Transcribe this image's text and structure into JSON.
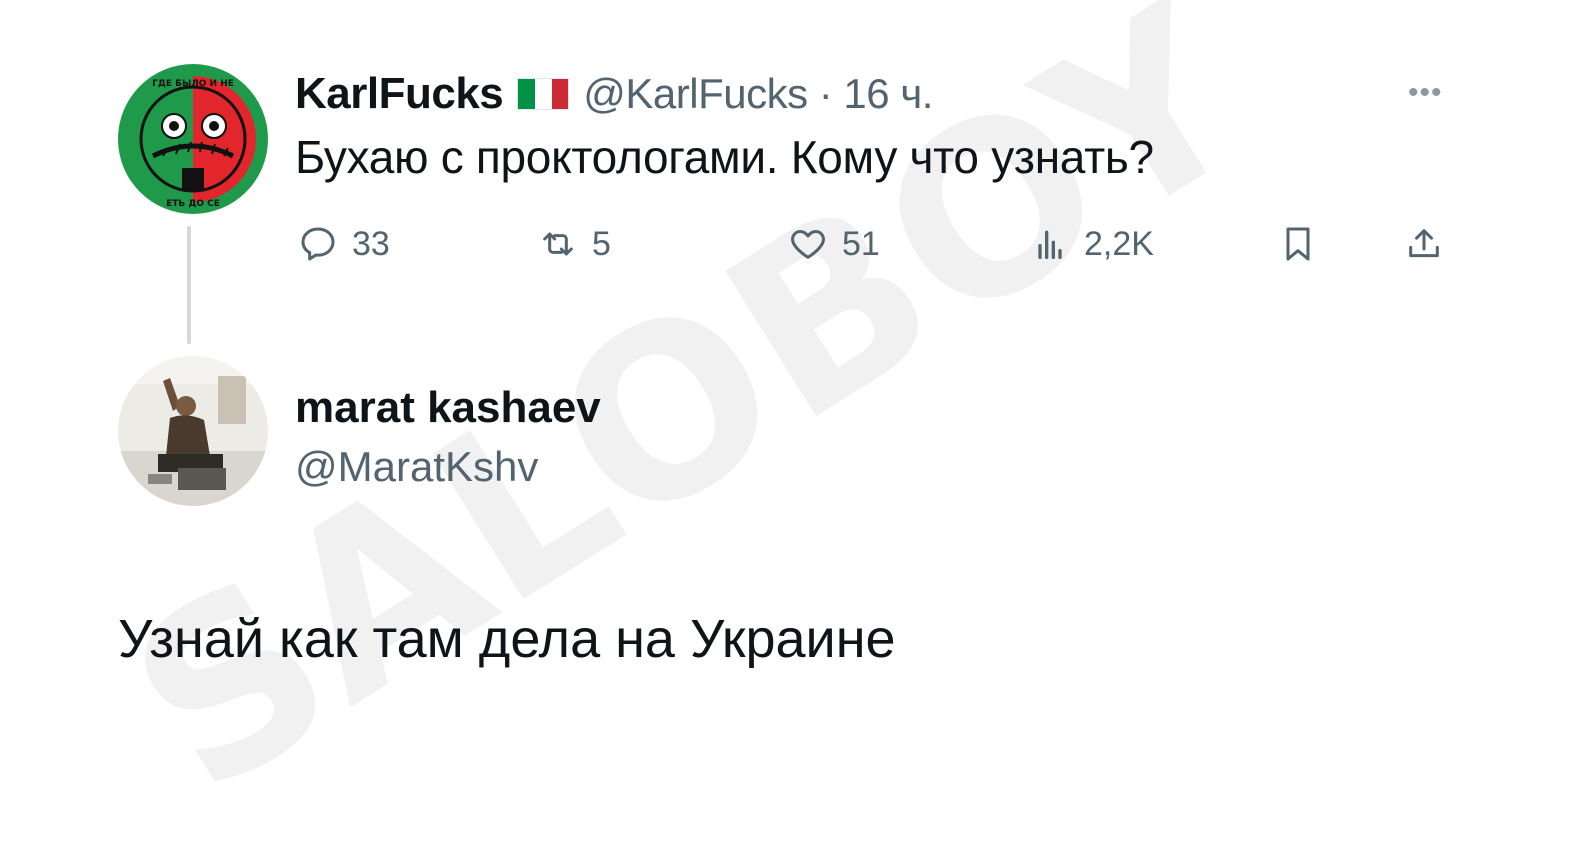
{
  "watermark": "SALOBOY",
  "tweet": {
    "author_name": "KarlFucks",
    "author_flag_colors": [
      "#009246",
      "#ffffff",
      "#ce2b37"
    ],
    "handle_time": "@KarlFucks · 16 ч.",
    "more_icon": "more-icon",
    "avatar_top_text": "ГДЕ БЫЛО И НЕ",
    "avatar_bottom_text": "ЕТЬ ДО СЕ",
    "text": "Бухаю с проктологами. Кому что узнать?",
    "actions": {
      "reply_count": "33",
      "retweet_count": "5",
      "like_count": "51",
      "views_count": "2,2K"
    }
  },
  "reply": {
    "author_name": "marat kashaev",
    "handle": "@MaratKshv",
    "text": "Узнай как там дела на Украине"
  },
  "colors": {
    "text_primary": "#0f1419",
    "text_secondary": "#536471",
    "thread_line": "#cfd9de",
    "avatar_green": "#1f9a4a",
    "avatar_red": "#e3262b"
  }
}
